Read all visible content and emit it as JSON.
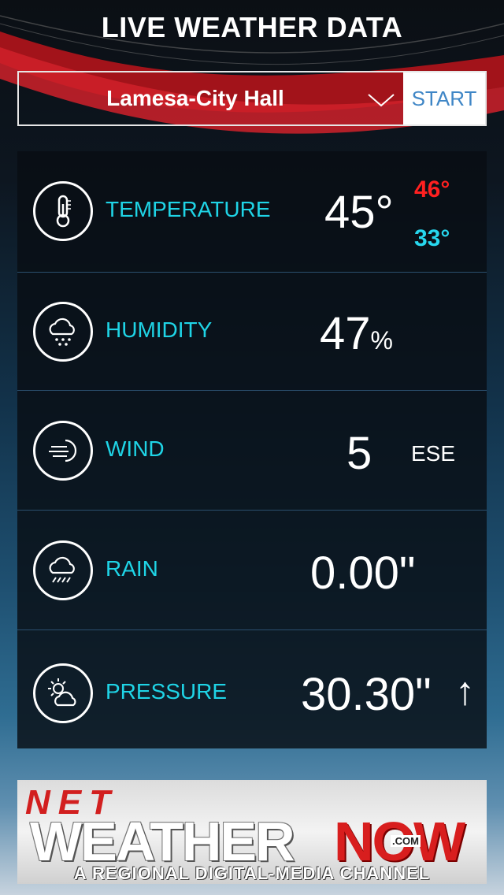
{
  "header": {
    "title": "LIVE WEATHER DATA"
  },
  "station_selector": {
    "station": "Lamesa-City Hall",
    "start_label": "START"
  },
  "rows": {
    "temperature": {
      "label": "TEMPERATURE",
      "value": "45°",
      "high": "46°",
      "low": "33°",
      "icon": "thermometer-icon"
    },
    "humidity": {
      "label": "HUMIDITY",
      "value": "47",
      "unit": "%",
      "icon": "humidity-cloud-icon"
    },
    "wind": {
      "label": "WIND",
      "value": "5",
      "direction": "ESE",
      "icon": "wind-icon"
    },
    "rain": {
      "label": "RAIN",
      "value": "0.00\"",
      "icon": "rain-cloud-icon"
    },
    "pressure": {
      "label": "PRESSURE",
      "value": "30.30\"",
      "trend": "↑",
      "icon": "sun-cloud-icon"
    }
  },
  "banner": {
    "net": "NET",
    "weather": "WEATHER",
    "now": "NOW",
    "com": ".COM",
    "tagline": "A REGIONAL DIGITAL-MEDIA CHANNEL"
  },
  "colors": {
    "accent_cyan": "#1fd4e6",
    "high_red": "#ff2020",
    "low_cyan": "#27d7ee",
    "start_blue": "#3f86c6"
  }
}
